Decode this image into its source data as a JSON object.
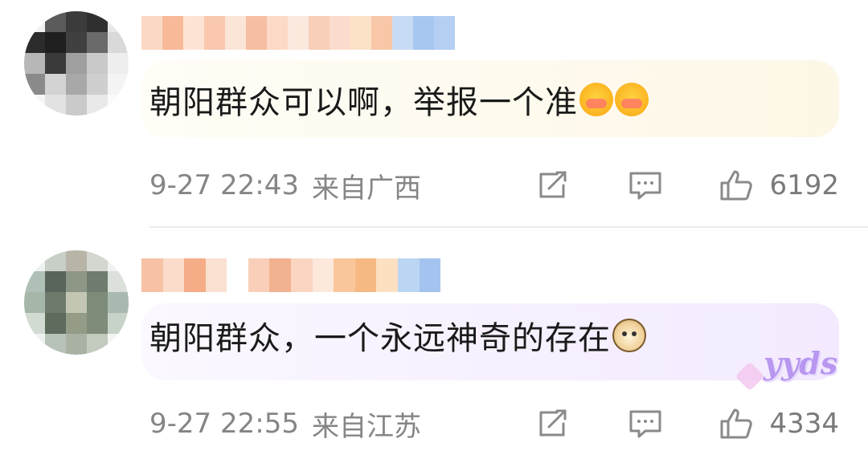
{
  "comments": [
    {
      "text": "朝阳群众可以啊，举报一个准",
      "emojis": [
        "blush-emoji",
        "blush-emoji"
      ],
      "time": "9-27 22:43",
      "location": "来自广西",
      "likes": "6192",
      "bubble_color": "#fdf7e7"
    },
    {
      "text": "朝阳群众，一个永远神奇的存在",
      "emojis": [
        "cat-emoji"
      ],
      "time": "9-27 22:55",
      "location": "来自江苏",
      "likes": "4334",
      "bubble_color": "#f3eaff",
      "decoration": "yyds"
    }
  ],
  "icons": {
    "share": "share-icon",
    "reply": "comment-icon",
    "like": "thumbs-up-icon"
  },
  "colors": {
    "meta_text": "#858585",
    "body_text": "#1a1a1a"
  }
}
